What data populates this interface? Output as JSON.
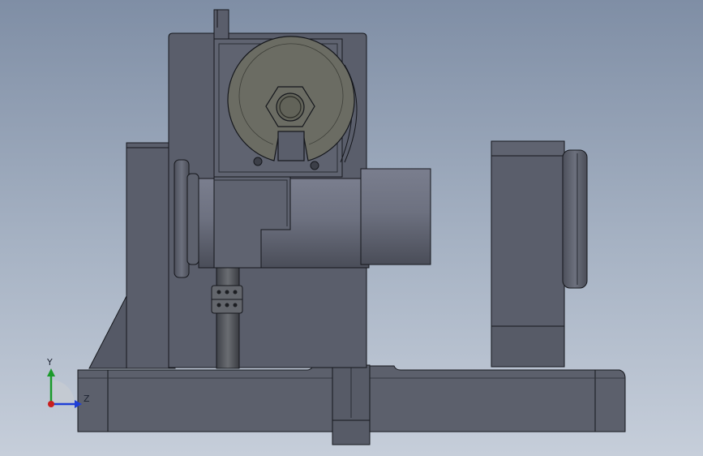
{
  "viewport": {
    "background_top": "#7f8ea5",
    "background_bottom": "#c6ceda"
  },
  "model": {
    "body_color": "#5b5f6c",
    "edge_color": "#15171c",
    "wheel_color": "#6b6c63",
    "shaft_color": "#6a6e7c"
  },
  "triad": {
    "y_label": "Y",
    "z_label": "Z",
    "y_color": "#1a9a2a",
    "z_color": "#1f3fd6",
    "x_color": "#c81e1e"
  }
}
